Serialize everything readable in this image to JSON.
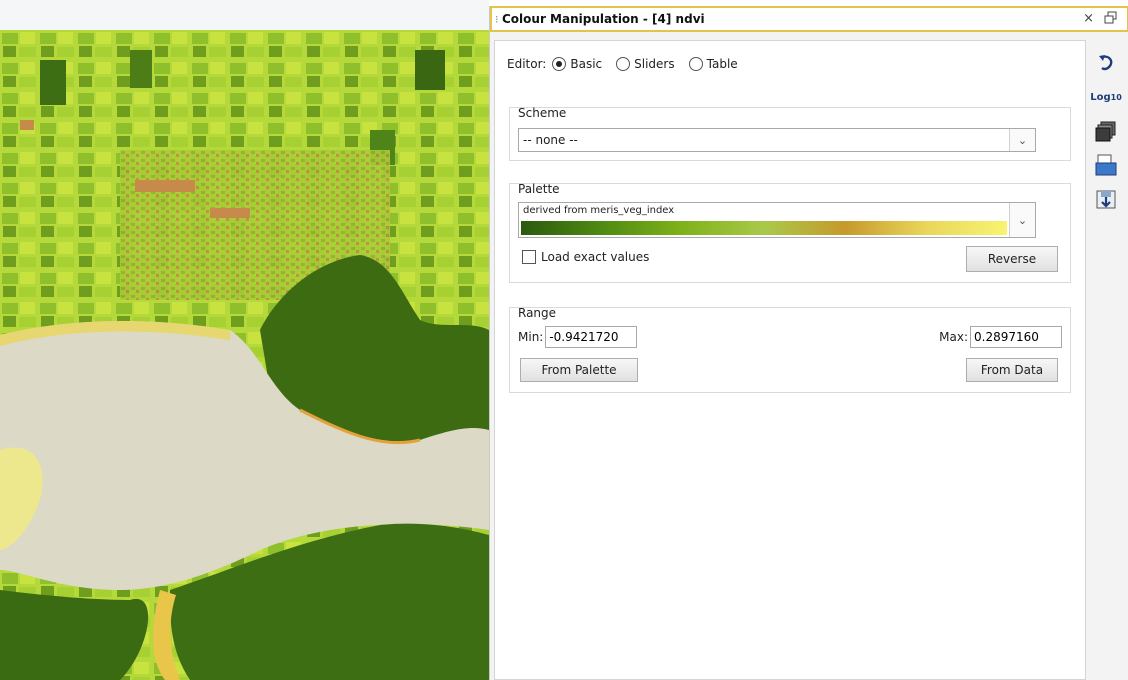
{
  "window": {
    "title": "Colour Manipulation - [4] ndvi",
    "close_glyph": "×",
    "float_glyph": "🗗"
  },
  "editor": {
    "label": "Editor:",
    "options": [
      {
        "label": "Basic",
        "selected": true
      },
      {
        "label": "Sliders",
        "selected": false
      },
      {
        "label": "Table",
        "selected": false
      }
    ]
  },
  "scheme": {
    "label": "Scheme",
    "value": "-- none --"
  },
  "palette": {
    "label": "Palette",
    "value": "derived from meris_veg_index",
    "gradient": [
      "#2b5a0f",
      "#4f8a12",
      "#7fb21a",
      "#a9c94a",
      "#c69a2c",
      "#e9d65a",
      "#f8f470"
    ],
    "load_exact_label": "Load exact values",
    "load_exact_checked": false,
    "reverse_label": "Reverse"
  },
  "range": {
    "label": "Range",
    "min_label": "Min:",
    "min_value": "-0.9421720",
    "max_label": "Max:",
    "max_value": "0.2897160",
    "from_palette_label": "From Palette",
    "from_data_label": "From Data"
  },
  "toolbar": {
    "log_label": "Log",
    "log_sub": "10",
    "icons": [
      "reset-icon",
      "log10-icon",
      "multi-apply-icon",
      "import-palette-icon",
      "export-palette-icon"
    ]
  },
  "colors": {
    "accent_border": "#e5c34b",
    "vegetation_dark": "#3d6b12",
    "vegetation_bright": "#b6dd33",
    "water": "#dcd9c7",
    "shore": "#e9c54a"
  }
}
